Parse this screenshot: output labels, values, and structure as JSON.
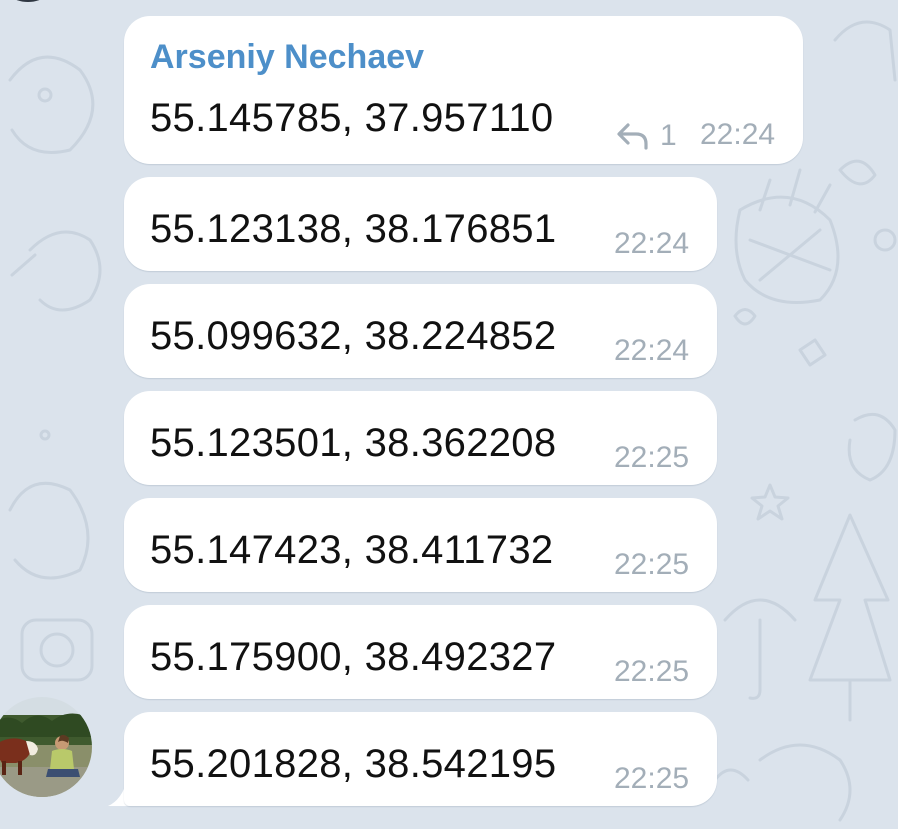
{
  "chat": {
    "sender_name": "Arseniy Nechaev",
    "reply_count": "1",
    "messages": [
      {
        "text": "55.145785, 37.957110",
        "time": "22:24"
      },
      {
        "text": "55.123138, 38.176851",
        "time": "22:24"
      },
      {
        "text": "55.099632, 38.224852",
        "time": "22:24"
      },
      {
        "text": "55.123501, 38.362208",
        "time": "22:25"
      },
      {
        "text": "55.147423, 38.411732",
        "time": "22:25"
      },
      {
        "text": "55.175900, 38.492327",
        "time": "22:25"
      },
      {
        "text": "55.201828, 38.542195",
        "time": "22:25"
      }
    ]
  },
  "icons": {
    "reply": "reply-arrow-icon",
    "avatar": "user-avatar-photo"
  },
  "colors": {
    "background": "#dbe3ec",
    "bubble": "#ffffff",
    "sender_name": "#4d8fc9",
    "message_text": "#111111",
    "meta_text": "#a3aeb8"
  }
}
